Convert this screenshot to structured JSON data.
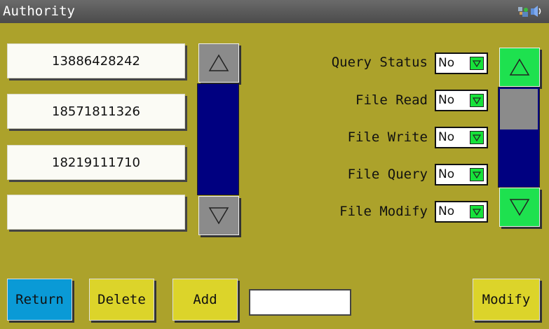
{
  "window": {
    "title": "Authority"
  },
  "phone_list": {
    "items": [
      "13886428242",
      "18571811326",
      "18219111710",
      ""
    ]
  },
  "permissions": [
    {
      "label": "Query Status",
      "value": "No"
    },
    {
      "label": "File Read",
      "value": "No"
    },
    {
      "label": "File Write",
      "value": "No"
    },
    {
      "label": "File Query",
      "value": "No"
    },
    {
      "label": "File Modify",
      "value": "No"
    }
  ],
  "buttons": {
    "return": "Return",
    "delete": "Delete",
    "add": "Add",
    "modify": "Modify"
  },
  "add_input": {
    "value": ""
  },
  "colors": {
    "background": "#aca22b",
    "scroll_track": "#000080",
    "scroll_arrow_green": "#1ee14f",
    "return_button": "#0a9ad6",
    "action_button": "#dcd42a"
  },
  "icons": [
    "network-icon",
    "speaker-icon",
    "triangle-up-icon",
    "triangle-down-icon",
    "dropdown-triangle-icon"
  ]
}
